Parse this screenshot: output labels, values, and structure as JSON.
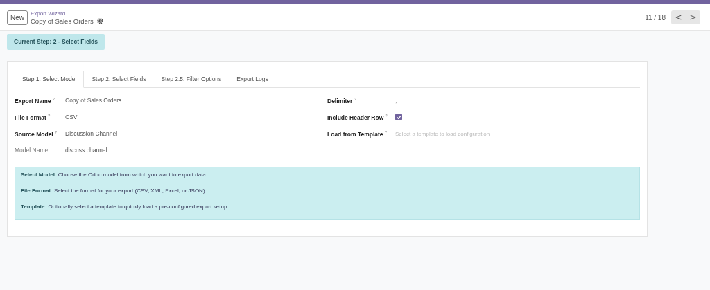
{
  "control_panel": {
    "new_button": "New",
    "breadcrumb": "Export Wizard",
    "record_title": "Copy of Sales Orders",
    "pager": "11 / 18",
    "prev": "<",
    "next": ">"
  },
  "status": "Current Step: 2 - Select Fields",
  "tabs": [
    {
      "label": "Step 1: Select Model",
      "selected": true
    },
    {
      "label": "Step 2: Select Fields",
      "selected": false
    },
    {
      "label": "Step 2.5: Filter Options",
      "selected": false
    },
    {
      "label": "Export Logs",
      "selected": false
    }
  ],
  "left_fields": [
    {
      "kind": "text",
      "label": "Export Name $^{?}$",
      "value": "Copy of Sales Orders",
      "required": true
    },
    {
      "kind": "text",
      "label": "File Format $^{?}$",
      "value": "CSV",
      "required": true
    },
    {
      "kind": "text",
      "label": "Source Model $^{?}$",
      "value": "Discussion Channel",
      "required": true
    },
    {
      "kind": "text",
      "label": "Model Name",
      "value": "discuss.channel",
      "required": false
    }
  ],
  "right_fields": [
    {
      "kind": "text",
      "label": "Delimiter $^{?}$",
      "value": ",",
      "required": true
    },
    {
      "kind": "checkbox",
      "label": "Include Header Row $^{?}$",
      "checked": true,
      "required": true
    },
    {
      "kind": "select",
      "label": "Load from Template $^{?}$",
      "placeholder": "Select a template to load configuration",
      "required": true
    }
  ],
  "help": [
    "**Select Model:** Choose the Odoo model from which you want to export data.",
    "**File Format:** Select the format for your export (CSV, XML, Excel, or JSON).",
    "**Template:** Optionally select a template to quickly load a pre-configured export setup."
  ]
}
